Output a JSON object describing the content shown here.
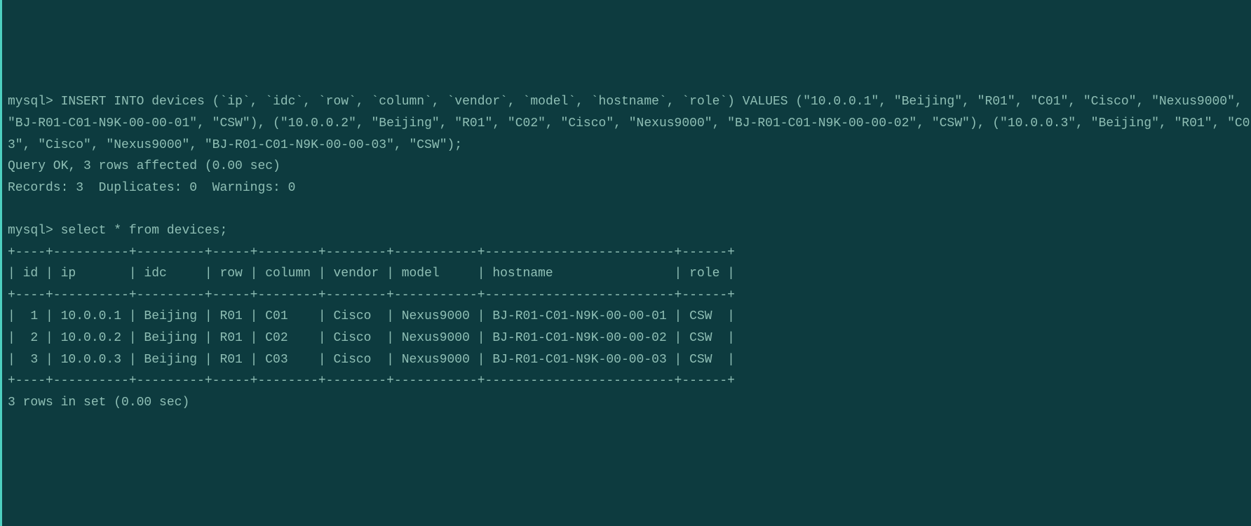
{
  "prompt": "mysql>",
  "insert_command": "INSERT INTO devices (`ip`, `idc`, `row`, `column`, `vendor`, `model`, `hostname`, `role`) VALUES (\"10.0.0.1\", \"Beijing\", \"R01\", \"C01\", \"Cisco\", \"Nexus9000\", \"BJ-R01-C01-N9K-00-00-01\", \"CSW\"), (\"10.0.0.2\", \"Beijing\", \"R01\", \"C02\", \"Cisco\", \"Nexus9000\", \"BJ-R01-C01-N9K-00-00-02\", \"CSW\"), (\"10.0.0.3\", \"Beijing\", \"R01\", \"C03\", \"Cisco\", \"Nexus9000\", \"BJ-R01-C01-N9K-00-00-03\", \"CSW\");",
  "query_ok": "Query OK, 3 rows affected (0.00 sec)",
  "records_line": "Records: 3  Duplicates: 0  Warnings: 0",
  "select_command": "select * from devices;",
  "table_border": "+----+----------+---------+-----+--------+--------+-----------+-------------------------+------+",
  "table_header": "| id | ip       | idc     | row | column | vendor | model     | hostname                | role |",
  "table_rows": [
    "|  1 | 10.0.0.1 | Beijing | R01 | C01    | Cisco  | Nexus9000 | BJ-R01-C01-N9K-00-00-01 | CSW  |",
    "|  2 | 10.0.0.2 | Beijing | R01 | C02    | Cisco  | Nexus9000 | BJ-R01-C01-N9K-00-00-02 | CSW  |",
    "|  3 | 10.0.0.3 | Beijing | R01 | C03    | Cisco  | Nexus9000 | BJ-R01-C01-N9K-00-00-03 | CSW  |"
  ],
  "rows_in_set": "3 rows in set (0.00 sec)",
  "chart_data": {
    "type": "table",
    "columns": [
      "id",
      "ip",
      "idc",
      "row",
      "column",
      "vendor",
      "model",
      "hostname",
      "role"
    ],
    "rows": [
      {
        "id": 1,
        "ip": "10.0.0.1",
        "idc": "Beijing",
        "row": "R01",
        "column": "C01",
        "vendor": "Cisco",
        "model": "Nexus9000",
        "hostname": "BJ-R01-C01-N9K-00-00-01",
        "role": "CSW"
      },
      {
        "id": 2,
        "ip": "10.0.0.2",
        "idc": "Beijing",
        "row": "R01",
        "column": "C02",
        "vendor": "Cisco",
        "model": "Nexus9000",
        "hostname": "BJ-R01-C01-N9K-00-00-02",
        "role": "CSW"
      },
      {
        "id": 3,
        "ip": "10.0.0.3",
        "idc": "Beijing",
        "row": "R01",
        "column": "C03",
        "vendor": "Cisco",
        "model": "Nexus9000",
        "hostname": "BJ-R01-C01-N9K-00-00-03",
        "role": "CSW"
      }
    ]
  }
}
